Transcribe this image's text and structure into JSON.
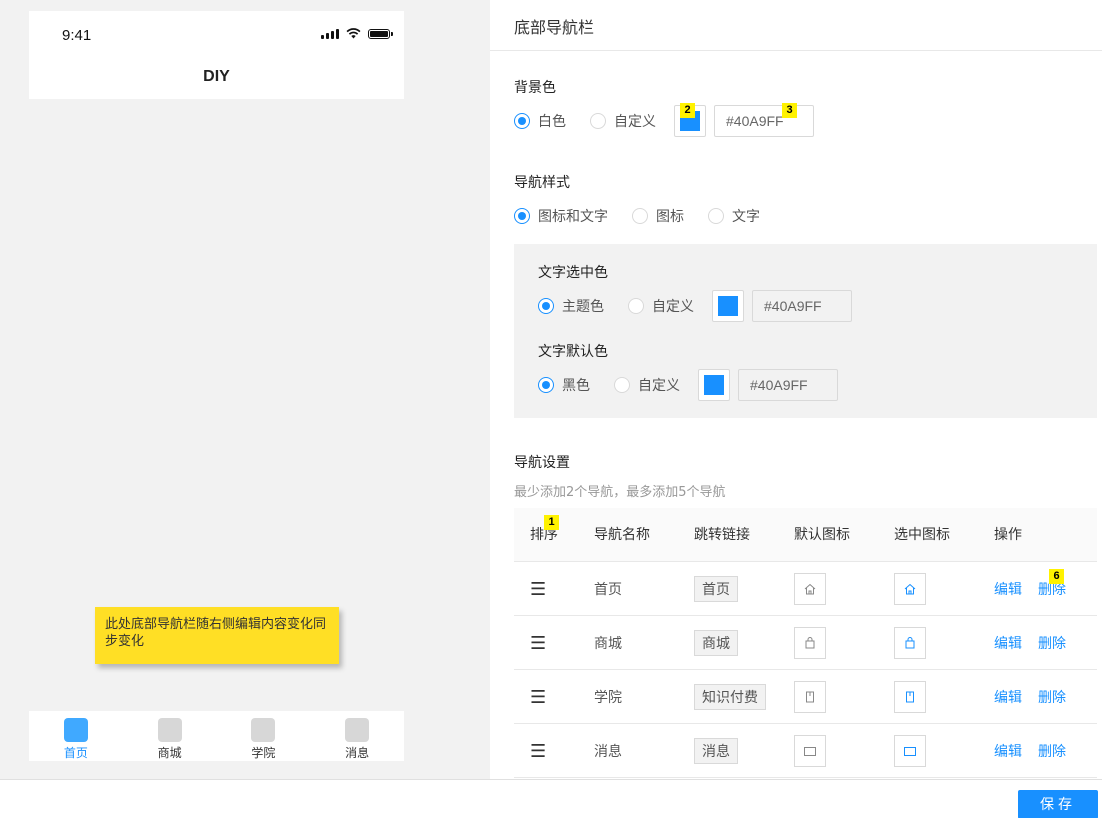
{
  "phone": {
    "status_time": "9:41",
    "page_title": "DIY",
    "sticky_note": "此处底部导航栏随右侧编辑内容变化同步变化",
    "tabs": [
      {
        "label": "首页",
        "active": true
      },
      {
        "label": "商城",
        "active": false
      },
      {
        "label": "学院",
        "active": false
      },
      {
        "label": "消息",
        "active": false
      }
    ]
  },
  "panel": {
    "title": "底部导航栏",
    "background": {
      "label": "背景色",
      "options": [
        "白色",
        "自定义"
      ],
      "selected": "白色",
      "hex": "#40A9FF",
      "badge_swatch": "2",
      "badge_hex": "3"
    },
    "nav_style": {
      "label": "导航样式",
      "options": [
        "图标和文字",
        "图标",
        "文字"
      ],
      "selected": "图标和文字"
    },
    "text_selected_color": {
      "label": "文字选中色",
      "options": [
        "主题色",
        "自定义"
      ],
      "selected": "主题色",
      "hex": "#40A9FF"
    },
    "text_default_color": {
      "label": "文字默认色",
      "options": [
        "黑色",
        "自定义"
      ],
      "selected": "黑色",
      "hex": "#40A9FF"
    },
    "nav_settings": {
      "label": "导航设置",
      "hint": "最少添加2个导航，最多添加5个导航",
      "columns": [
        "排序",
        "导航名称",
        "跳转链接",
        "默认图标",
        "选中图标",
        "操作"
      ],
      "badge_sort": "1",
      "badge_delete": "6",
      "rows": [
        {
          "name": "首页",
          "link": "首页",
          "icon": "home-icon",
          "edit": "编辑",
          "delete": "删除"
        },
        {
          "name": "商城",
          "link": "商城",
          "icon": "bag-icon",
          "edit": "编辑",
          "delete": "删除"
        },
        {
          "name": "学院",
          "link": "知识付费",
          "icon": "book-icon",
          "edit": "编辑",
          "delete": "删除"
        },
        {
          "name": "消息",
          "link": "消息",
          "icon": "message-icon",
          "edit": "编辑",
          "delete": "删除"
        }
      ]
    }
  },
  "footer": {
    "save_label": "保存"
  },
  "colors": {
    "accent": "#1890ff",
    "swatch": "#40A9FF",
    "sticky": "#ffdf25",
    "badge": "#fff200"
  }
}
